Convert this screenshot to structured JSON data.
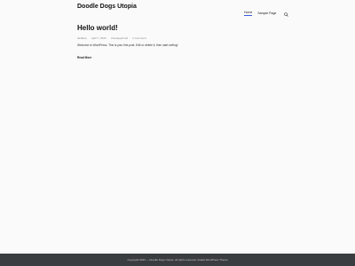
{
  "site": {
    "title": "Doodle Dogs Utopia"
  },
  "nav": {
    "items": [
      {
        "label": "Home"
      },
      {
        "label": "Sample Page"
      }
    ]
  },
  "post": {
    "title": "Hello world!",
    "author": "dwdlacy",
    "date": "April 7, 2023",
    "category": "Uncategorized",
    "comments": "1 Comment",
    "excerpt": "Welcome to WordPress. This is your first post. Edit or delete it, then start writing!",
    "read_more": "Read More"
  },
  "footer": {
    "text": "Copyright 2023 — Doodle Dogs Utopia. All rights reserved. Avada WordPress Theme"
  }
}
